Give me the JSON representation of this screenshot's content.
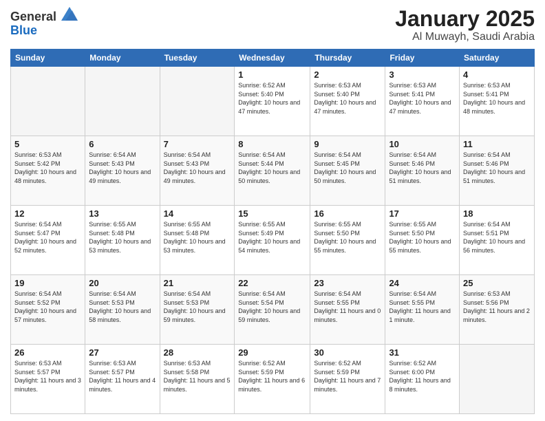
{
  "logo": {
    "line1": "General",
    "line2": "Blue"
  },
  "header": {
    "month_title": "January 2025",
    "subtitle": "Al Muwayh, Saudi Arabia"
  },
  "weekdays": [
    "Sunday",
    "Monday",
    "Tuesday",
    "Wednesday",
    "Thursday",
    "Friday",
    "Saturday"
  ],
  "weeks": [
    [
      {
        "day": "",
        "sunrise": "",
        "sunset": "",
        "daylight": "",
        "empty": true
      },
      {
        "day": "",
        "sunrise": "",
        "sunset": "",
        "daylight": "",
        "empty": true
      },
      {
        "day": "",
        "sunrise": "",
        "sunset": "",
        "daylight": "",
        "empty": true
      },
      {
        "day": "1",
        "sunrise": "Sunrise: 6:52 AM",
        "sunset": "Sunset: 5:40 PM",
        "daylight": "Daylight: 10 hours and 47 minutes."
      },
      {
        "day": "2",
        "sunrise": "Sunrise: 6:53 AM",
        "sunset": "Sunset: 5:40 PM",
        "daylight": "Daylight: 10 hours and 47 minutes."
      },
      {
        "day": "3",
        "sunrise": "Sunrise: 6:53 AM",
        "sunset": "Sunset: 5:41 PM",
        "daylight": "Daylight: 10 hours and 47 minutes."
      },
      {
        "day": "4",
        "sunrise": "Sunrise: 6:53 AM",
        "sunset": "Sunset: 5:41 PM",
        "daylight": "Daylight: 10 hours and 48 minutes."
      }
    ],
    [
      {
        "day": "5",
        "sunrise": "Sunrise: 6:53 AM",
        "sunset": "Sunset: 5:42 PM",
        "daylight": "Daylight: 10 hours and 48 minutes."
      },
      {
        "day": "6",
        "sunrise": "Sunrise: 6:54 AM",
        "sunset": "Sunset: 5:43 PM",
        "daylight": "Daylight: 10 hours and 49 minutes."
      },
      {
        "day": "7",
        "sunrise": "Sunrise: 6:54 AM",
        "sunset": "Sunset: 5:43 PM",
        "daylight": "Daylight: 10 hours and 49 minutes."
      },
      {
        "day": "8",
        "sunrise": "Sunrise: 6:54 AM",
        "sunset": "Sunset: 5:44 PM",
        "daylight": "Daylight: 10 hours and 50 minutes."
      },
      {
        "day": "9",
        "sunrise": "Sunrise: 6:54 AM",
        "sunset": "Sunset: 5:45 PM",
        "daylight": "Daylight: 10 hours and 50 minutes."
      },
      {
        "day": "10",
        "sunrise": "Sunrise: 6:54 AM",
        "sunset": "Sunset: 5:46 PM",
        "daylight": "Daylight: 10 hours and 51 minutes."
      },
      {
        "day": "11",
        "sunrise": "Sunrise: 6:54 AM",
        "sunset": "Sunset: 5:46 PM",
        "daylight": "Daylight: 10 hours and 51 minutes."
      }
    ],
    [
      {
        "day": "12",
        "sunrise": "Sunrise: 6:54 AM",
        "sunset": "Sunset: 5:47 PM",
        "daylight": "Daylight: 10 hours and 52 minutes."
      },
      {
        "day": "13",
        "sunrise": "Sunrise: 6:55 AM",
        "sunset": "Sunset: 5:48 PM",
        "daylight": "Daylight: 10 hours and 53 minutes."
      },
      {
        "day": "14",
        "sunrise": "Sunrise: 6:55 AM",
        "sunset": "Sunset: 5:48 PM",
        "daylight": "Daylight: 10 hours and 53 minutes."
      },
      {
        "day": "15",
        "sunrise": "Sunrise: 6:55 AM",
        "sunset": "Sunset: 5:49 PM",
        "daylight": "Daylight: 10 hours and 54 minutes."
      },
      {
        "day": "16",
        "sunrise": "Sunrise: 6:55 AM",
        "sunset": "Sunset: 5:50 PM",
        "daylight": "Daylight: 10 hours and 55 minutes."
      },
      {
        "day": "17",
        "sunrise": "Sunrise: 6:55 AM",
        "sunset": "Sunset: 5:50 PM",
        "daylight": "Daylight: 10 hours and 55 minutes."
      },
      {
        "day": "18",
        "sunrise": "Sunrise: 6:54 AM",
        "sunset": "Sunset: 5:51 PM",
        "daylight": "Daylight: 10 hours and 56 minutes."
      }
    ],
    [
      {
        "day": "19",
        "sunrise": "Sunrise: 6:54 AM",
        "sunset": "Sunset: 5:52 PM",
        "daylight": "Daylight: 10 hours and 57 minutes."
      },
      {
        "day": "20",
        "sunrise": "Sunrise: 6:54 AM",
        "sunset": "Sunset: 5:53 PM",
        "daylight": "Daylight: 10 hours and 58 minutes."
      },
      {
        "day": "21",
        "sunrise": "Sunrise: 6:54 AM",
        "sunset": "Sunset: 5:53 PM",
        "daylight": "Daylight: 10 hours and 59 minutes."
      },
      {
        "day": "22",
        "sunrise": "Sunrise: 6:54 AM",
        "sunset": "Sunset: 5:54 PM",
        "daylight": "Daylight: 10 hours and 59 minutes."
      },
      {
        "day": "23",
        "sunrise": "Sunrise: 6:54 AM",
        "sunset": "Sunset: 5:55 PM",
        "daylight": "Daylight: 11 hours and 0 minutes."
      },
      {
        "day": "24",
        "sunrise": "Sunrise: 6:54 AM",
        "sunset": "Sunset: 5:55 PM",
        "daylight": "Daylight: 11 hours and 1 minute."
      },
      {
        "day": "25",
        "sunrise": "Sunrise: 6:53 AM",
        "sunset": "Sunset: 5:56 PM",
        "daylight": "Daylight: 11 hours and 2 minutes."
      }
    ],
    [
      {
        "day": "26",
        "sunrise": "Sunrise: 6:53 AM",
        "sunset": "Sunset: 5:57 PM",
        "daylight": "Daylight: 11 hours and 3 minutes."
      },
      {
        "day": "27",
        "sunrise": "Sunrise: 6:53 AM",
        "sunset": "Sunset: 5:57 PM",
        "daylight": "Daylight: 11 hours and 4 minutes."
      },
      {
        "day": "28",
        "sunrise": "Sunrise: 6:53 AM",
        "sunset": "Sunset: 5:58 PM",
        "daylight": "Daylight: 11 hours and 5 minutes."
      },
      {
        "day": "29",
        "sunrise": "Sunrise: 6:52 AM",
        "sunset": "Sunset: 5:59 PM",
        "daylight": "Daylight: 11 hours and 6 minutes."
      },
      {
        "day": "30",
        "sunrise": "Sunrise: 6:52 AM",
        "sunset": "Sunset: 5:59 PM",
        "daylight": "Daylight: 11 hours and 7 minutes."
      },
      {
        "day": "31",
        "sunrise": "Sunrise: 6:52 AM",
        "sunset": "Sunset: 6:00 PM",
        "daylight": "Daylight: 11 hours and 8 minutes."
      },
      {
        "day": "",
        "sunrise": "",
        "sunset": "",
        "daylight": "",
        "empty": true
      }
    ]
  ]
}
